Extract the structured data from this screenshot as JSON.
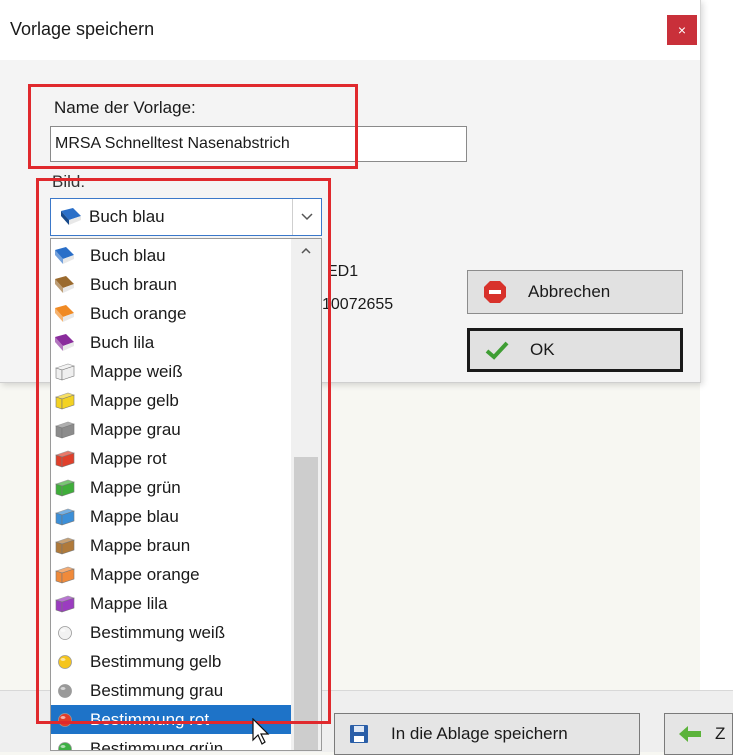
{
  "dialog": {
    "title": "Vorlage speichern",
    "close_label": "×",
    "name_label": "Name der Vorlage:",
    "name_value": "MRSA Schnelltest Nasenabstrich",
    "image_label": "Bild:",
    "image_selected": "Buch blau",
    "partial_text_1": "ED1",
    "partial_text_2": "10072655",
    "cancel_label": "Abbrechen",
    "ok_label": "OK"
  },
  "dropdown_items": [
    {
      "label": "Buch blau",
      "icon": "book-blue-icon",
      "color": "#2a6fc8"
    },
    {
      "label": "Buch braun",
      "icon": "book-brown-icon",
      "color": "#9a6a2e"
    },
    {
      "label": "Buch orange",
      "icon": "book-orange-icon",
      "color": "#f08a24"
    },
    {
      "label": "Buch lila",
      "icon": "book-purple-icon",
      "color": "#8a2c9c"
    },
    {
      "label": "Mappe weiß",
      "icon": "folder-white-icon",
      "color": "#efefef"
    },
    {
      "label": "Mappe gelb",
      "icon": "folder-yellow-icon",
      "color": "#f3d223"
    },
    {
      "label": "Mappe grau",
      "icon": "folder-gray-icon",
      "color": "#8c8c8c"
    },
    {
      "label": "Mappe rot",
      "icon": "folder-red-icon",
      "color": "#e0402b"
    },
    {
      "label": "Mappe grün",
      "icon": "folder-green-icon",
      "color": "#3fae3a"
    },
    {
      "label": "Mappe blau",
      "icon": "folder-blue-icon",
      "color": "#3c8fd8"
    },
    {
      "label": "Mappe braun",
      "icon": "folder-brown-icon",
      "color": "#b07a3a"
    },
    {
      "label": "Mappe orange",
      "icon": "folder-orange-icon",
      "color": "#f08a3a"
    },
    {
      "label": "Mappe lila",
      "icon": "folder-purple-icon",
      "color": "#9b3cc0"
    },
    {
      "label": "Bestimmung weiß",
      "icon": "dot-white-icon",
      "color": "#f2f2f2"
    },
    {
      "label": "Bestimmung gelb",
      "icon": "dot-yellow-icon",
      "color": "#f5c51e"
    },
    {
      "label": "Bestimmung grau",
      "icon": "dot-gray-icon",
      "color": "#9a9a9a"
    },
    {
      "label": "Bestimmung rot",
      "icon": "dot-red-icon",
      "color": "#e33b2a",
      "selected": true
    },
    {
      "label": "Bestimmung grün",
      "icon": "dot-green-icon",
      "color": "#3cb043"
    }
  ],
  "footer": {
    "save_to_clipboard_label": "In die Ablage speichern",
    "partial_button_label": "Z"
  }
}
